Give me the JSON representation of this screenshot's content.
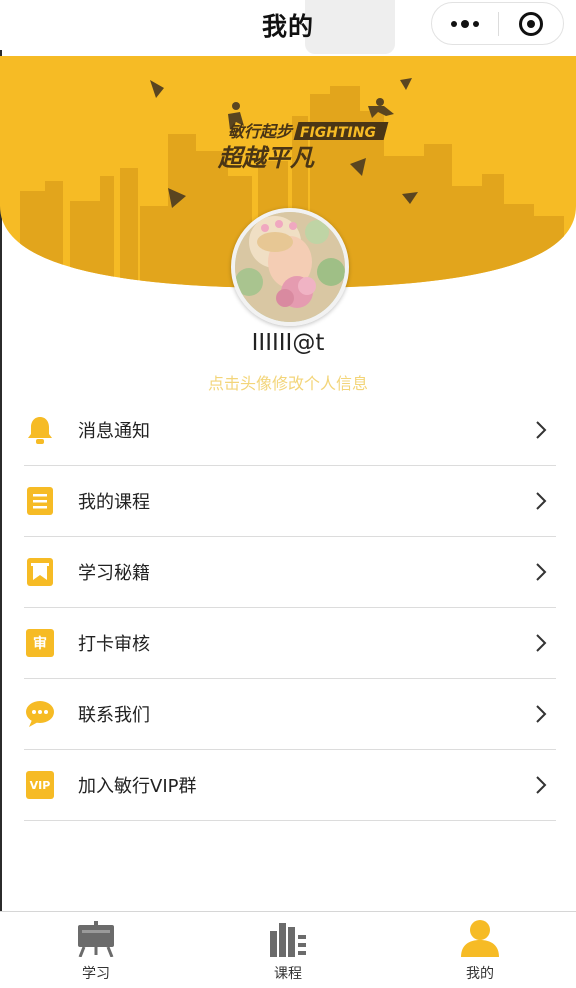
{
  "nav": {
    "title": "我的"
  },
  "banner": {
    "slogan_small": "敏行起步",
    "slogan_tag": "FIGHTING",
    "slogan_big": "超越平凡",
    "color": "#f6bb25"
  },
  "profile": {
    "username": "IIIIII@t",
    "hint": "点击头像修改个人信息"
  },
  "menu": {
    "items": [
      {
        "label": "消息通知",
        "icon": "bell-icon"
      },
      {
        "label": "我的课程",
        "icon": "course-list-icon"
      },
      {
        "label": "学习秘籍",
        "icon": "bookmark-icon"
      },
      {
        "label": "打卡审核",
        "icon": "review-icon",
        "glyph": "审"
      },
      {
        "label": "联系我们",
        "icon": "chat-bubble-icon"
      },
      {
        "label": "加入敏行VIP群",
        "icon": "vip-icon",
        "glyph": "VIP"
      }
    ]
  },
  "tabbar": {
    "tabs": [
      {
        "label": "学习",
        "icon": "easel-icon"
      },
      {
        "label": "课程",
        "icon": "books-icon"
      },
      {
        "label": "我的",
        "icon": "person-icon"
      }
    ],
    "active_index": 2,
    "active_color": "#f6bb25",
    "inactive_color": "#6b6b6b"
  }
}
